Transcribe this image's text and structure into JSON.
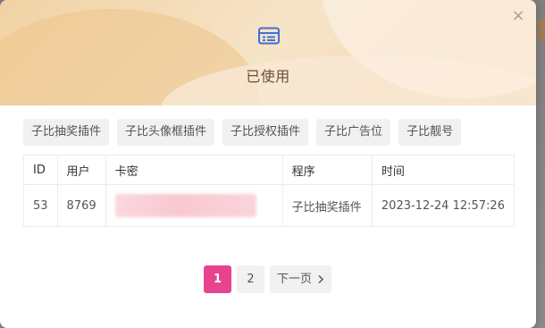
{
  "modal": {
    "title": "已使用",
    "close_glyph": "×",
    "icon": "card-icon",
    "accent_color": "#e8438f",
    "title_color": "#6b4f36"
  },
  "tabs": [
    {
      "label": "子比抽奖插件"
    },
    {
      "label": "子比头像框插件"
    },
    {
      "label": "子比授权插件"
    },
    {
      "label": "子比广告位"
    },
    {
      "label": "子比靓号"
    }
  ],
  "table": {
    "headers": [
      "ID",
      "用户",
      "卡密",
      "程序",
      "时间"
    ],
    "rows": [
      {
        "id": "53",
        "user": "8769",
        "card": "",
        "program": "子比抽奖插件",
        "time": "2023-12-24 12:57:26"
      }
    ]
  },
  "pagination": {
    "pages": [
      "1",
      "2"
    ],
    "current": "1",
    "next_label": "下一页",
    "next_icon": "chevron-right-icon"
  }
}
